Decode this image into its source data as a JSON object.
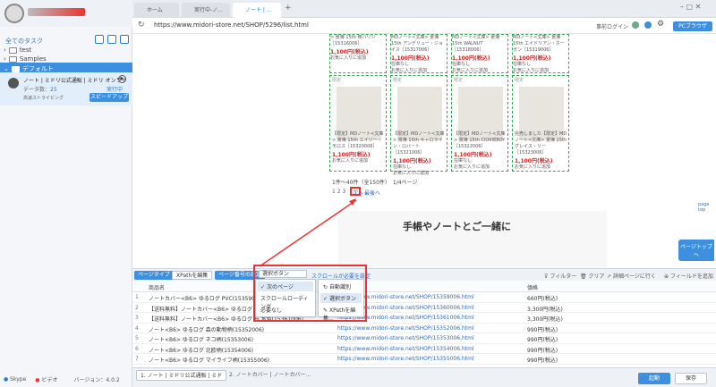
{
  "sidebar": {
    "title": "全てのタスク",
    "folders": [
      "test",
      "Samples",
      "デフォルト"
    ],
    "task": {
      "name": "ノート | ミドリ公式通販 | ミドリ オンライ",
      "data_label": "データ数：",
      "data_count": "25",
      "status": "実行中",
      "mode": "高速ストライピング",
      "speedup": "スピードアップ"
    },
    "footer": {
      "skype": "Skype",
      "video": "ビデオ",
      "version": "バージョン：4.0.2"
    }
  },
  "browser": {
    "tabs": [
      "ホーム",
      "実行中-ノ...",
      "ノート | ..."
    ],
    "url": "https://www.midori-store.net/SHOP/5296/list.html",
    "login": "事前ログイン",
    "pc_browser": "PCブラウザ"
  },
  "content": {
    "products_top": [
      {
        "desc": "> 景簿 15th 用パリジ ［15316006］",
        "price": "1,100円(税込)",
        "fav": "お気に入りに追加"
      },
      {
        "desc": "MDノート<文庫> 景簿 15th アンデリュー・ジョイス［15317006］",
        "price": "1,100円(税込)",
        "stock": "在庫なし",
        "fav": "お気に入りに追加"
      },
      {
        "desc": "MDノート<文庫> 景簿 15th WALNUT ［15318006］",
        "price": "1,100円(税込)",
        "stock": "在庫なし",
        "fav": "お気に入りに追加"
      },
      {
        "desc": "MDノート<文庫> 景簿 15th エイドリアン・ホーガン［15319006］",
        "price": "1,100円(税込)",
        "stock": "在庫なし",
        "fav": "お気に入りに追加"
      }
    ],
    "products_bottom": [
      {
        "badge": "限定",
        "desc": "【限定】MDノート<文庫> 景簿 15th エイリー・モロス［15320006］",
        "price": "1,100円(税込)",
        "fav": "お気に入りに追加"
      },
      {
        "badge": "限定",
        "desc": "【限定】MDノート<文庫> 景簿 15th キャロライン・ロバート［15321006］",
        "price": "1,100円(税込)",
        "stock": "在庫なし",
        "fav": "お気に入りに追加"
      },
      {
        "badge": "限定",
        "desc": "【限定】MDノート<文庫> 景簿 15th CIOKIEBOY［15322006］",
        "price": "1,100円(税込)",
        "stock": "在庫なし",
        "fav": "お気に入りに追加"
      },
      {
        "badge": "限定",
        "desc": "完売しました【限定】MDノート<文庫> 景簿 15th グレイス・リー［15323006］",
        "price": "1,100円(税込)",
        "fav": "お気に入りに追加"
      }
    ],
    "pagination_summary": "1件〜40件（全150件）　1/4ページ",
    "pages": "1 2 3",
    "next_page": "次へ",
    "last_page": "最後へ",
    "page_top": "page top",
    "banner": "手帳やノートとご一緒に",
    "float_btn": "ページトップへ"
  },
  "toolbar": {
    "page_type": "ページタイプ",
    "xpath_edit": "XPathを編集",
    "page_num_setting": "ページ番号の設定",
    "select_label": "選択ボタン",
    "scroll_link": "スクロールが必要を設定",
    "filter": "フィルター",
    "clear": "クリア",
    "detail": "詳細ページに行く",
    "add_field": "フィールドを追加"
  },
  "dropdown": {
    "left": [
      "次のページ",
      "スクロールローディング",
      "必要なし"
    ],
    "right": [
      "自動識別",
      "選択ボタン",
      "XPathを編集..."
    ]
  },
  "table": {
    "headers": [
      "商品名",
      "",
      "価格"
    ],
    "rows": [
      {
        "n": "1",
        "name": "ノートカバー<B6> ゆるログ PVC(15359006)",
        "url": "https://www.midori-store.net/SHOP/15359006.html",
        "price": "660円(税込)"
      },
      {
        "n": "2",
        "name": "【送料無料】ノートカバー<B6> ゆるログ 布 ベージ...",
        "url": "https://www.midori-store.net/SHOP/15360006.html",
        "price": "3,300円(税込)"
      },
      {
        "n": "3",
        "name": "【送料無料】ノートカバー<B6> ゆるログ 布 水色(15361006)",
        "url": "https://www.midori-store.net/SHOP/15361006.html",
        "price": "3,300円(税込)"
      },
      {
        "n": "4",
        "name": "ノート<B6> ゆるログ 森の動物柄(15352006)",
        "url": "https://www.midori-store.net/SHOP/15352006.html",
        "price": "990円(税込)"
      },
      {
        "n": "5",
        "name": "ノート<B6> ゆるログ ネコ柄(15353006)",
        "url": "https://www.midori-store.net/SHOP/15353006.html",
        "price": "990円(税込)"
      },
      {
        "n": "6",
        "name": "ノート<B6> ゆるログ 北欧柄(15354006)",
        "url": "https://www.midori-store.net/SHOP/15354006.html",
        "price": "990円(税込)"
      },
      {
        "n": "7",
        "name": "ノート<B6> ゆるログ マイライフ柄(15355006)",
        "url": "https://www.midori-store.net/SHOP/15355006.html",
        "price": "990円(税込)"
      }
    ]
  },
  "bottom": {
    "tab1": "1. ノート | ミドリ公式通販 | ミド",
    "tab2": "2. ノートカバー | ノートカバー...",
    "start": "起動",
    "save": "保存"
  }
}
